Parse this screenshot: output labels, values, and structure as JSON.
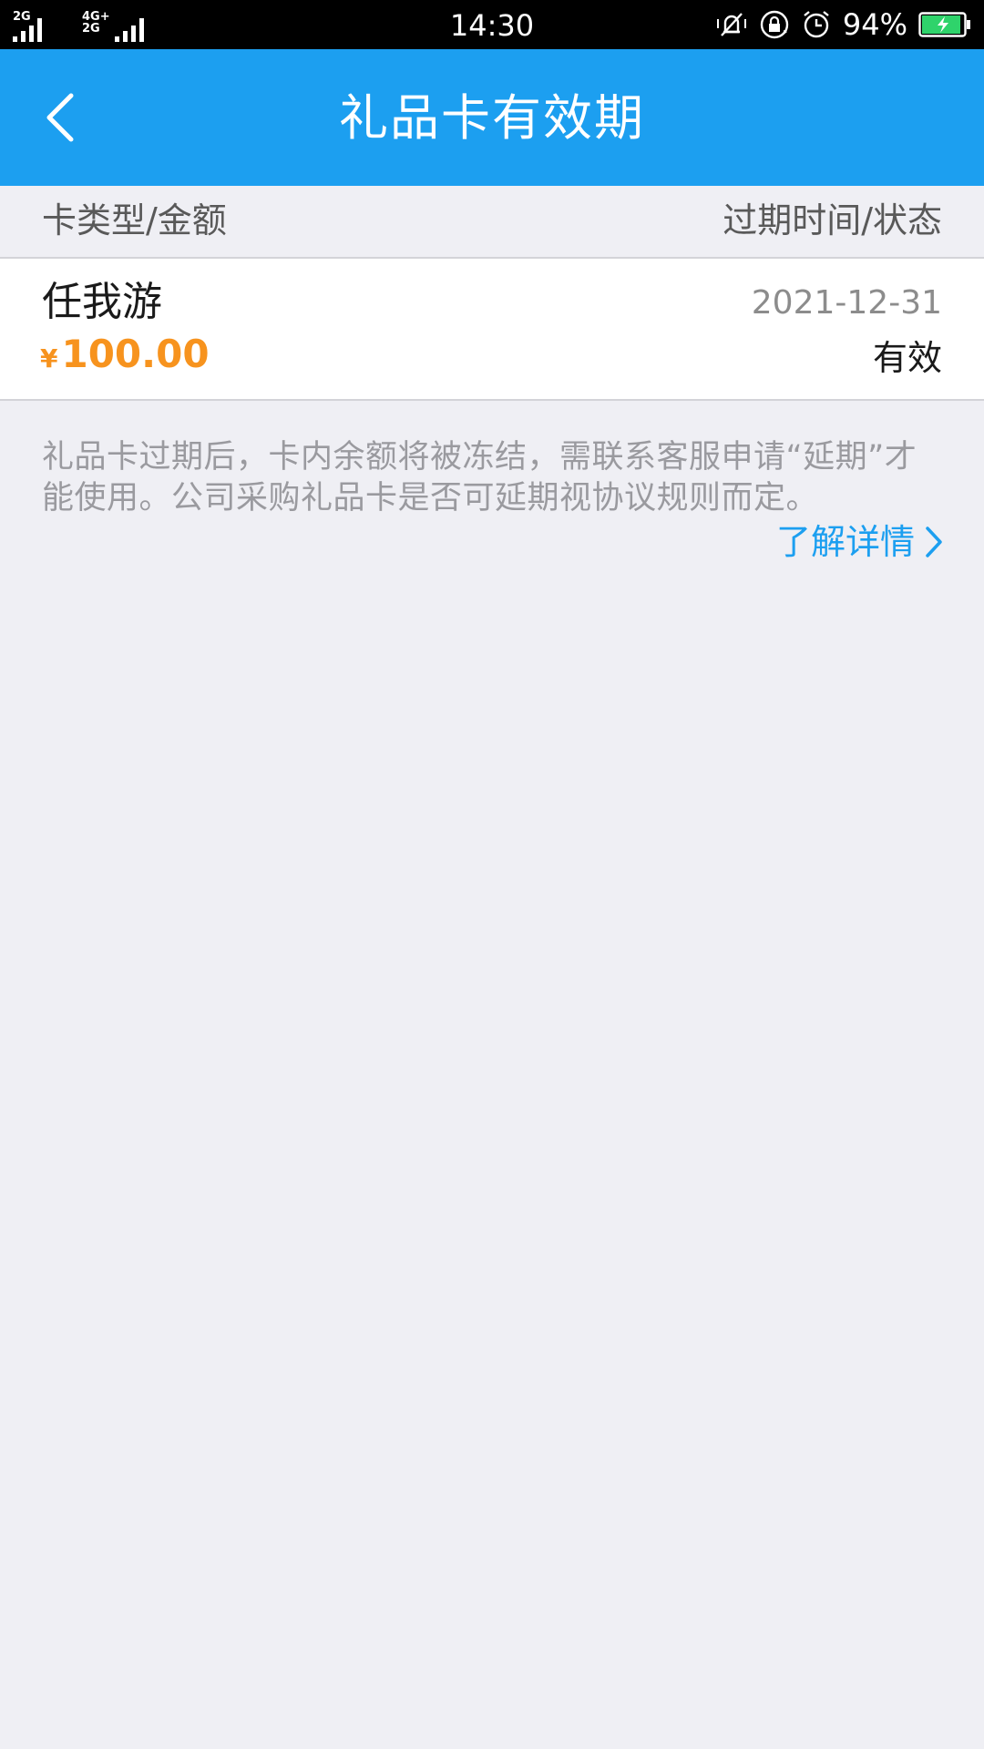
{
  "status_bar": {
    "sim1_label": "2G",
    "sim2_label": "4G+ 2G",
    "time": "14:30",
    "battery_percent": "94%",
    "battery_level": 0.94,
    "icons": [
      "signal-icon",
      "mute-vibrate-icon",
      "rotation-lock-icon",
      "alarm-icon",
      "battery-charging-icon"
    ]
  },
  "header": {
    "title": "礼品卡有效期",
    "back_icon": "chevron-left-icon"
  },
  "columns": {
    "left": "卡类型/金额",
    "right": "过期时间/状态"
  },
  "cards": [
    {
      "name": "任我游",
      "currency": "¥",
      "amount": "100.00",
      "expiry": "2021-12-31",
      "status": "有效"
    }
  ],
  "notice": {
    "text": "礼品卡过期后，卡内余额将被冻结，需联系客服申请“延期”才能使用。公司采购礼品卡是否可延期视协议规则而定。",
    "link_label": "了解详情",
    "link_icon": "chevron-right-icon"
  },
  "colors": {
    "header_bg": "#1c9ff0",
    "page_bg": "#efeff4",
    "amount": "#f7931e",
    "link": "#1c9ff0",
    "battery": "#2fd36b"
  }
}
